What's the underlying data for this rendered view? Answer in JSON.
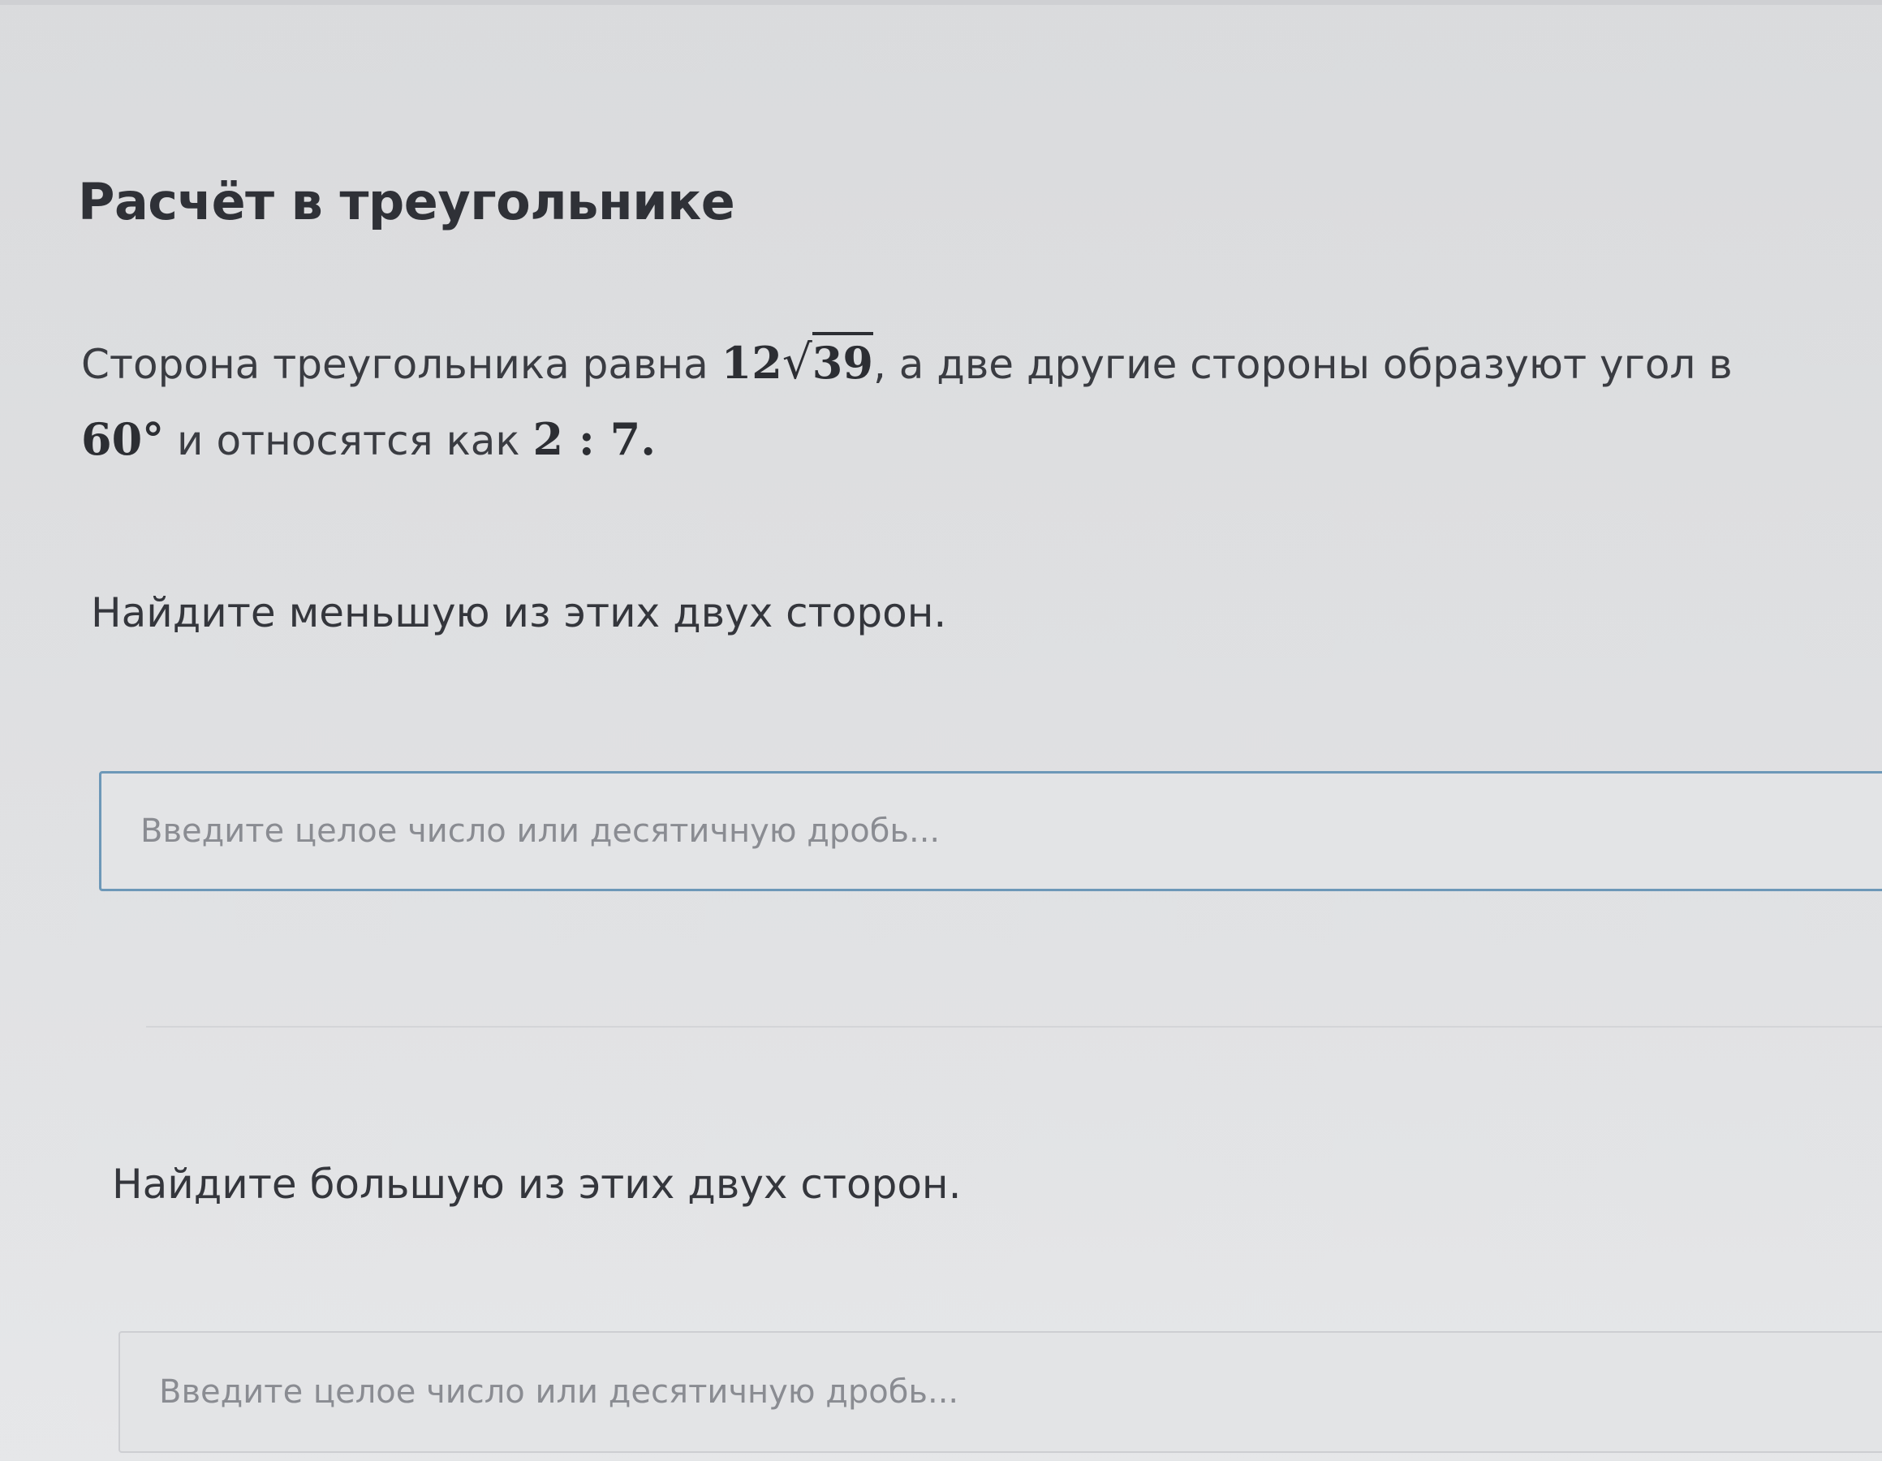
{
  "title": "Расчёт в треугольнике",
  "statement": {
    "part1": "Сторона треугольника равна ",
    "side_coef": "12",
    "sqrt_symbol": "√",
    "side_radicand": "39",
    "part2": ", а две другие стороны образуют угол в ",
    "angle": "60°",
    "part3": " и относятся как ",
    "ratio": "2 : 7",
    "part4": "."
  },
  "questions": [
    {
      "text": "Найдите меньшую из этих двух сторон.",
      "placeholder": "Введите целое число или десятичную дробь..."
    },
    {
      "text": "Найдите большую из этих двух сторон.",
      "placeholder": "Введите целое число или десятичную дробь..."
    }
  ],
  "colors": {
    "focused_field_border": "#6d98b8",
    "field_border": "#cdced2",
    "background": "#dedfe1"
  }
}
